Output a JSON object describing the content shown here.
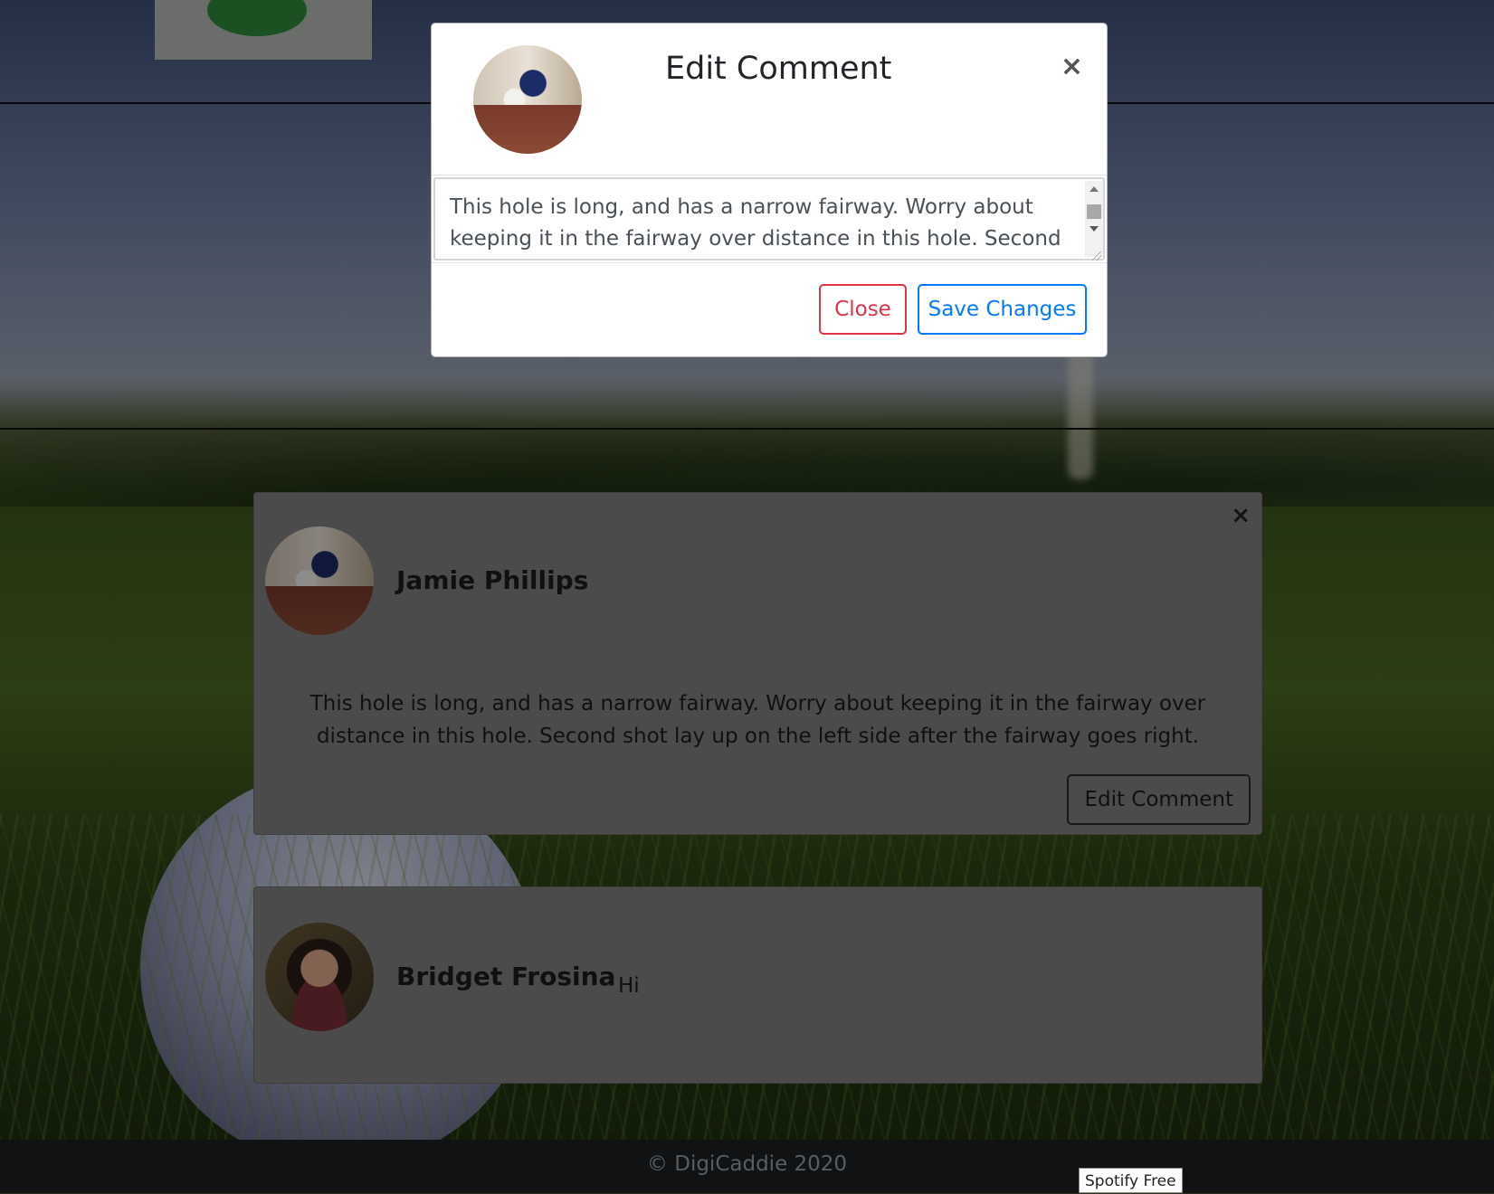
{
  "colors": {
    "danger": "#dc3545",
    "primary": "#007bff",
    "footer_bg": "#1c1f23",
    "card_bg": "#818181"
  },
  "modal": {
    "title": "Edit Comment",
    "close_icon": "×",
    "textarea_value": "This hole is long, and has a narrow fairway. Worry about keeping it in the fairway over distance in this hole. Second shot lay up on the left side after the fairway goes right.",
    "close_button": "Close",
    "save_button": "Save Changes"
  },
  "comments": [
    {
      "author": "Jamie Phillips",
      "close_icon": "×",
      "text": "This hole is long, and has a narrow fairway. Worry about keeping it in the fairway over distance in this hole. Second shot lay up on the left side after the fairway goes right.",
      "edit_button": "Edit Comment"
    },
    {
      "author": "Bridget Frosina",
      "text": "Hi"
    }
  ],
  "footer": {
    "copyright": "© DigiCaddie 2020"
  },
  "tooltip": {
    "text": "Spotify Free"
  }
}
